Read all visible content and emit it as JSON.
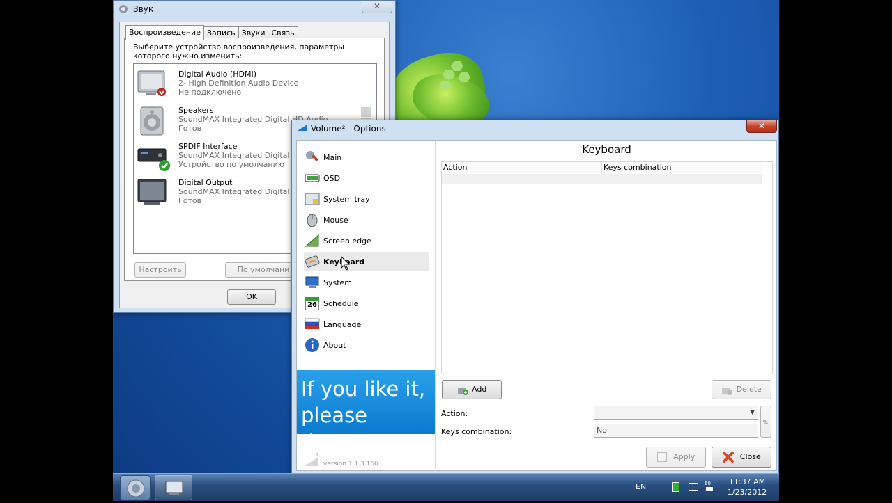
{
  "sound_dialog": {
    "title": "Звук",
    "tabs": [
      "Воспроизведение",
      "Запись",
      "Звуки",
      "Связь"
    ],
    "description": "Выберите устройство воспроизведения, параметры которого нужно изменить:",
    "devices": [
      {
        "name": "Digital Audio (HDMI)",
        "line2": "2- High Definition Audio Device",
        "line3": "Не подключено"
      },
      {
        "name": "Speakers",
        "line2": "SoundMAX Integrated Digital HD Audio",
        "line3": "Готов"
      },
      {
        "name": "SPDIF Interface",
        "line2": "SoundMAX Integrated Digital HD",
        "line3": "Устройство по умолчанию"
      },
      {
        "name": "Digital Output",
        "line2": "SoundMAX Integrated Digital HD",
        "line3": "Готов"
      }
    ],
    "configure_label": "Настроить",
    "default_label": "По умолчани",
    "ok_label": "OK"
  },
  "volume_options": {
    "title": "Volume² - Options",
    "nav": [
      "Main",
      "OSD",
      "System tray",
      "Mouse",
      "Screen edge",
      "Keyboard",
      "System",
      "Schedule",
      "Language",
      "About"
    ],
    "selected_nav": "Keyboard",
    "schedule_icon_text": "26",
    "donate_text": "If you like it, please donate",
    "version": "version 1.1.3.166",
    "logo_text": "2",
    "content_title": "Keyboard",
    "columns": [
      "Action",
      "Keys combination"
    ],
    "add_label": "Add",
    "delete_label": "Delete",
    "action_label": "Action:",
    "keys_label": "Keys combination:",
    "keys_value": "No",
    "apply_label": "Apply",
    "close_label": "Close"
  },
  "taskbar": {
    "lang": "EN",
    "tray_number": "60",
    "time": "11:37 AM",
    "date": "1/23/2012"
  }
}
